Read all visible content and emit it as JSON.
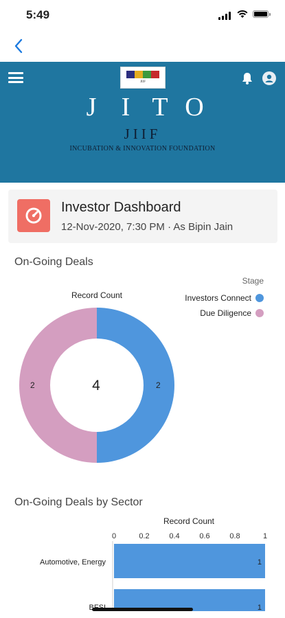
{
  "status_bar": {
    "time": "5:49"
  },
  "banner": {
    "bg_color": "#1f76a0",
    "logo_letters": [
      "J",
      "I",
      "T",
      "O"
    ],
    "logo_colors": [
      "#2d2f7f",
      "#e4ad20",
      "#3d9a3e",
      "#c62a2c"
    ],
    "logo_subtitle": "JIIF",
    "logo_tagline": "INCUBATION & INNOVATION FOUNDATION"
  },
  "dashboard": {
    "title": "Investor Dashboard",
    "subtitle": "12-Nov-2020, 7:30 PM  ·  As Bipin Jain",
    "icon": "dashboard-gauge-icon",
    "icon_color": "#ef6e64"
  },
  "deals_chart": {
    "section_title": "On-Going Deals",
    "caption": "Record Count",
    "legend_title": "Stage",
    "total": "4",
    "slice_labels": [
      "2",
      "2"
    ]
  },
  "sector_chart": {
    "section_title": "On-Going Deals by Sector",
    "caption": "Record Count",
    "tick_labels": [
      "0",
      "0.2",
      "0.4",
      "0.6",
      "0.8",
      "1"
    ]
  },
  "chart_data": [
    {
      "type": "pie",
      "title": "Record Count",
      "legend_title": "Stage",
      "legend_position": "top-right",
      "categories": [
        "Investors Connect",
        "Due Diligence"
      ],
      "values": [
        2,
        2
      ],
      "colors": [
        "#4f96dd",
        "#d49ec0"
      ],
      "center_total": 4
    },
    {
      "type": "bar",
      "orientation": "horizontal",
      "title": "Record Count",
      "categories": [
        "Automotive, Energy",
        "BFSI"
      ],
      "values": [
        1,
        1
      ],
      "xlim": [
        0,
        1
      ],
      "color": "#4f96dd"
    }
  ]
}
